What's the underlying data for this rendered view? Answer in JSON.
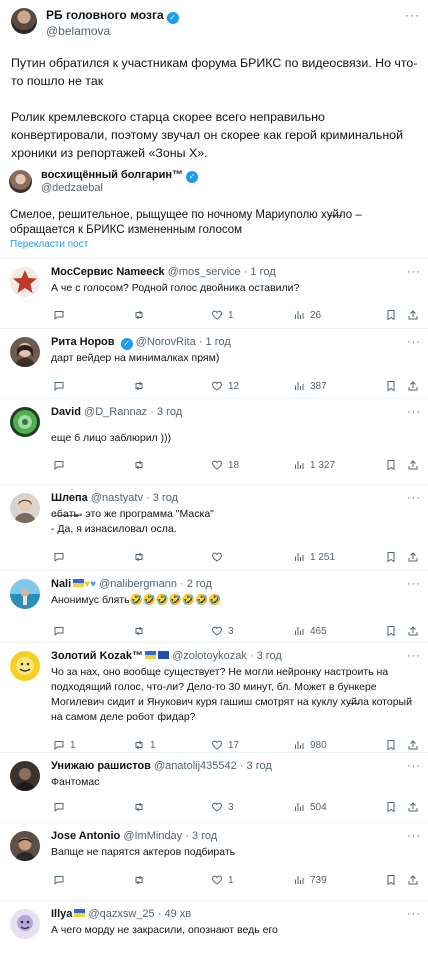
{
  "main_tweet": {
    "name": "РБ головного мозга",
    "handle": "@belamova",
    "more": "···",
    "text": "Путин обратился к участникам форума БРИКС по видеосвязи. Но что-то пошло не так\n\nРолик кремлевского старца скорее всего неправильно конвертировали, поэтому звучал он скорее как герой криминальной хроники из репортажей «Зоны Х».",
    "verified_mark": "✓"
  },
  "quote": {
    "name": "восхищённый болгарин™",
    "handle": "@dedzaebal",
    "verified_mark": "✓",
    "text": "Смелое, решительное, рыщущее по ночному Мариуполю ху̶й̶ло – обращается к БРИКС измененным голосом",
    "translate": "Перекласти пост"
  },
  "replies": [
    {
      "name": "МосСервис Nameeck",
      "handle": "@mos_service",
      "time": "· 1 год",
      "text": "А че с голосом? Родной голос двойника оставили?",
      "replies": "",
      "retweets": "",
      "likes": "1",
      "views": "26",
      "avatar": "star"
    },
    {
      "name": "Рита Норов",
      "handle": "@NorovRita",
      "time": "· 1 год",
      "text": "дарт вейдер на минималках прям)",
      "replies": "",
      "retweets": "",
      "likes": "12",
      "views": "387",
      "avatar": "woman"
    },
    {
      "name": "David",
      "handle": "@D_Rannaz",
      "time": "· 3 год",
      "text": "еще б лицо заблюрил )))",
      "replies": "",
      "retweets": "",
      "likes": "18",
      "views": "1 327",
      "avatar": "green"
    },
    {
      "name": "Шлепа",
      "handle": "@nastyatv",
      "time": "· 3 год",
      "text": "е̶б̶а̶т̶ь̶- это же программа \"Маска\"\n- Да, я изнасиловал осла.",
      "replies": "",
      "retweets": "",
      "likes": "",
      "views": "1 251",
      "avatar": "person"
    },
    {
      "name": "Nali",
      "handle": "@nalibergmann",
      "time": "· 2 год",
      "text": "Анонимус блять🤣🤣🤣🤣🤣🤣🤣",
      "replies": "",
      "retweets": "",
      "likes": "3",
      "views": "465",
      "avatar": "beach"
    },
    {
      "name": "Золотий Kozak™",
      "handle": "@zolotoykozak",
      "time": "· 3 год",
      "text": "Чо за нах, оно вообще существует? Не могли нейронку настроить на подходящий голос, что-ли? Дело-то 30 минут, бл. Может в бункере Могилевич сидит и Янукович куря гашиш смотрят на куклу ху̶й̶ла который на самом деле робот фидар?",
      "replies": "1",
      "retweets": "1",
      "likes": "17",
      "views": "980",
      "avatar": "yellow"
    },
    {
      "name": "Унижаю рашистов",
      "handle": "@anatolij435542",
      "time": "· 3 год",
      "text": "Фантомас",
      "replies": "",
      "retweets": "",
      "likes": "3",
      "views": "504",
      "avatar": "dark"
    },
    {
      "name": "Jose Antonio",
      "handle": "@ImMinday",
      "time": "· 3 год",
      "text": "Вапще не парятся актеров подбирать",
      "replies": "",
      "retweets": "",
      "likes": "1",
      "views": "739",
      "avatar": "man"
    },
    {
      "name": "Illya",
      "handle": "@qazxsw_25",
      "time": "· 49 хв",
      "text": "А чего морду не закрасили, опознают ведь его",
      "replies": "",
      "retweets": "",
      "likes": "",
      "views": "",
      "avatar": "cartoon"
    }
  ]
}
